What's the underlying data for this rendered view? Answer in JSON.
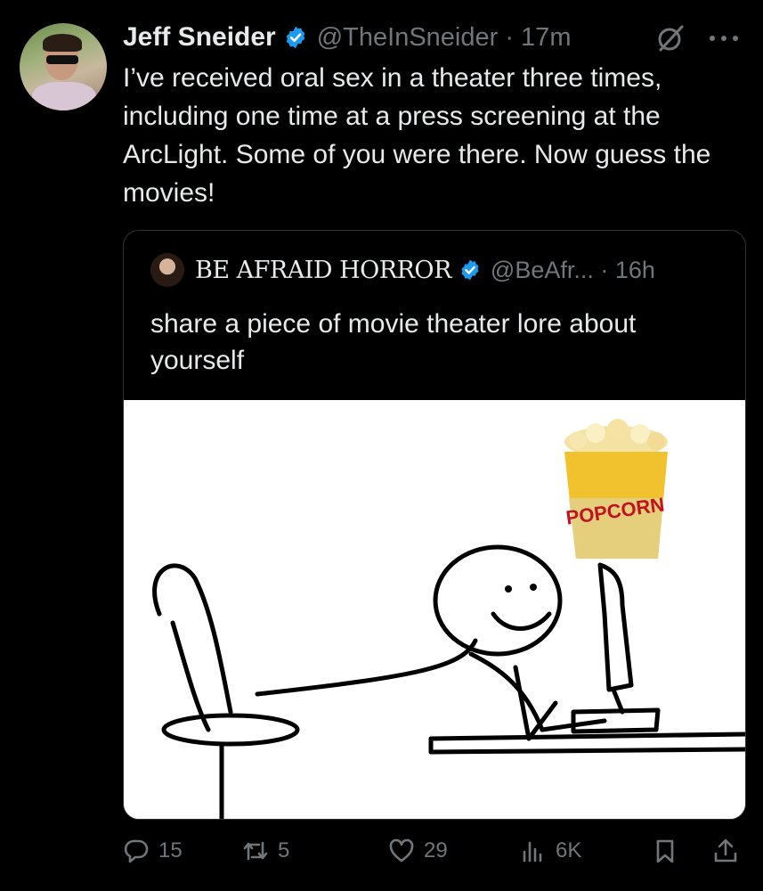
{
  "tweet": {
    "author_name": "Jeff Sneider",
    "handle_time": "@TheInSneider · 17m",
    "text": "I’ve received oral sex in a theater three times, including one time at a press screening at the ArcLight. Some of you were there. Now guess the movies!"
  },
  "quote": {
    "author_name": "BE AFRAID HORROR",
    "handle_time": "@BeAfr... · 16h",
    "text": "share a piece of movie theater lore about yourself",
    "image_text": "POPCORN"
  },
  "actions": {
    "replies": "15",
    "reposts": "5",
    "likes": "29",
    "views": "6K"
  },
  "colors": {
    "background": "#000000",
    "text": "#e7e9ea",
    "muted": "#71767b",
    "verified": "#1d9bf0",
    "border": "#2f3336"
  },
  "icons": [
    "verified-badge-icon",
    "grok-icon",
    "more-icon",
    "reply-icon",
    "repost-icon",
    "like-icon",
    "views-icon",
    "bookmark-icon",
    "share-icon"
  ]
}
